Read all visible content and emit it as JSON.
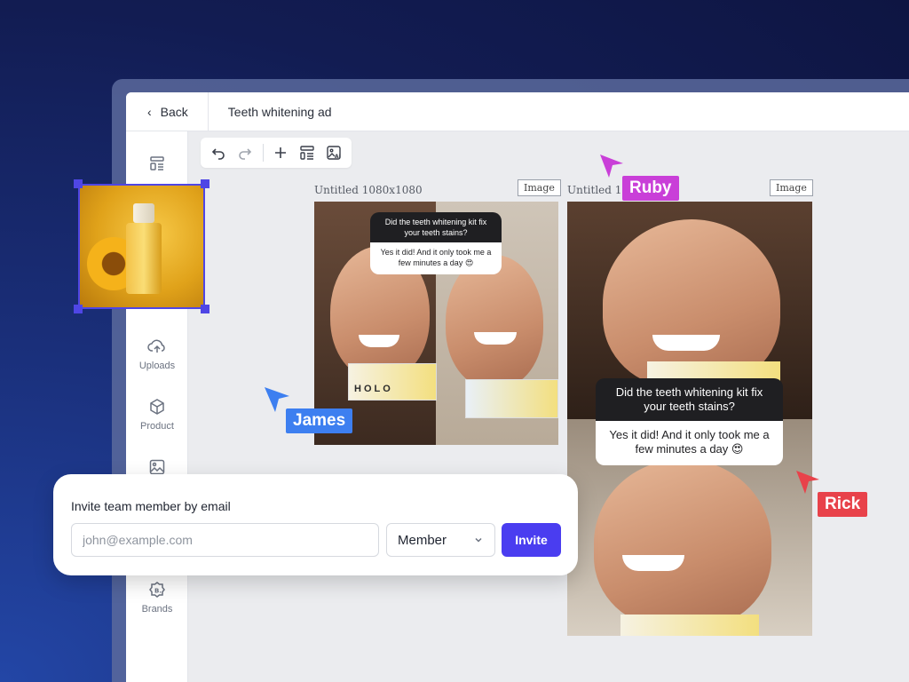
{
  "header": {
    "back_label": "Back",
    "doc_title": "Teeth whitening ad"
  },
  "sidebar": {
    "items": [
      {
        "label": "",
        "icon": "template-icon"
      },
      {
        "label": "Uploads",
        "icon": "upload-cloud-icon"
      },
      {
        "label": "Product",
        "icon": "cube-icon"
      },
      {
        "label": "",
        "icon": "image-icon"
      },
      {
        "label": "Brands",
        "icon": "brand-badge-icon"
      }
    ]
  },
  "toolbar": {
    "icons": [
      "undo-icon",
      "redo-icon",
      "plus-icon",
      "layout-icon",
      "ai-image-icon"
    ]
  },
  "canvases": [
    {
      "label": "Untitled 1080x1080",
      "tag": "Image",
      "question": "Did the teeth whitening kit fix your teeth stains?",
      "answer": "Yes it did! And it only took me a few minutes a day 😍",
      "brand_text": "HOLO"
    },
    {
      "label": "Untitled 10",
      "tag": "Image",
      "question": "Did the teeth whitening kit fix your teeth stains?",
      "answer": "Yes it did! And it only took me a few minutes a day 😍"
    }
  ],
  "collaborators": [
    {
      "name": "Ruby",
      "color": "#c93fd8"
    },
    {
      "name": "James",
      "color": "#3d7ff0"
    },
    {
      "name": "Rick",
      "color": "#e8424a"
    }
  ],
  "invite": {
    "title": "Invite team member by email",
    "email_placeholder": "john@example.com",
    "email_value": "",
    "role_value": "Member",
    "submit_label": "Invite"
  },
  "colors": {
    "accent": "#4a3df0",
    "selection": "#4f46e5"
  }
}
